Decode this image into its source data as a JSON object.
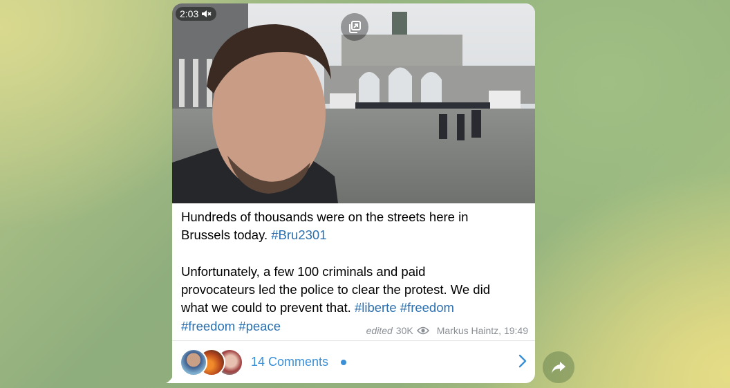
{
  "video": {
    "duration": "2:03",
    "mute_icon": "speaker-muted-icon",
    "pip_icon": "picture-in-picture-icon"
  },
  "message": {
    "line1": "Hundreds of thousands were on the streets here in",
    "line2_text": "Brussels today. ",
    "line2_tag": "#Bru2301",
    "line3": "Unfortunately, a few 100 criminals and paid",
    "line4": "provocateurs led the police to clear the protest. We did",
    "line5_text": "what we could to prevent that. ",
    "line5_tag1": "#liberte",
    "line5_tag2": "#freedom",
    "line6_tag1": "#freedom",
    "line6_tag2": "#peace"
  },
  "meta": {
    "edited": "edited",
    "views": "30K",
    "author_time": "Markus Haintz, 19:49"
  },
  "comments": {
    "label": "14 Comments"
  },
  "colors": {
    "link": "#2a6fb0",
    "accent": "#3a8fd6"
  }
}
